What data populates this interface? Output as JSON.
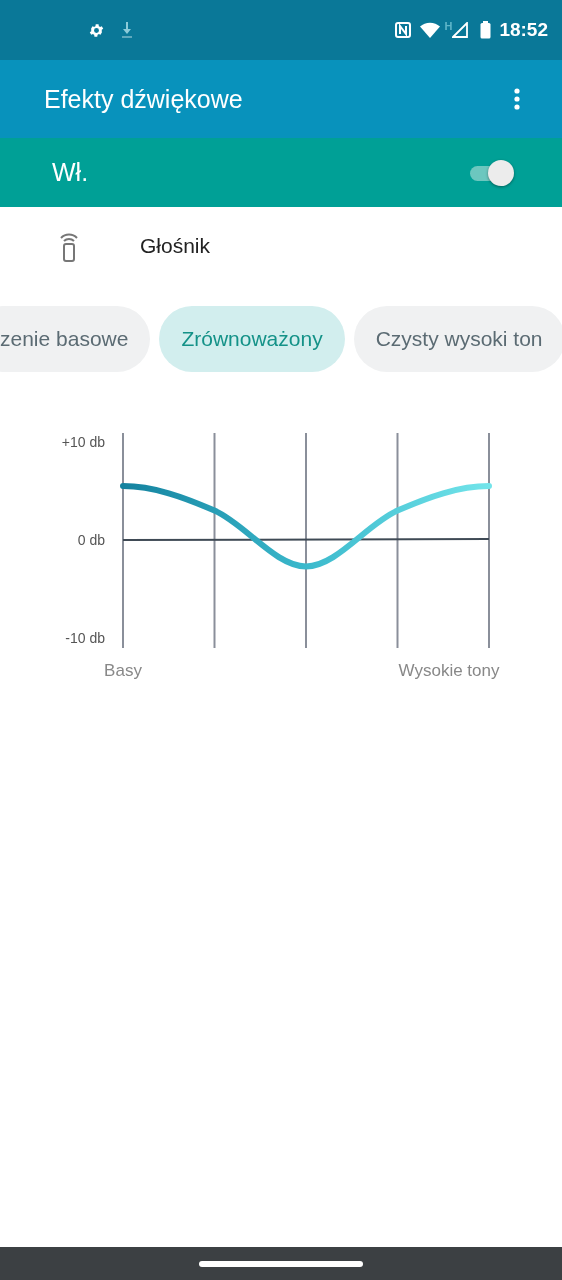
{
  "status_bar": {
    "network_type": "H",
    "time": "18:52"
  },
  "app_bar": {
    "title": "Efekty dźwiękowe"
  },
  "master_switch": {
    "label": "Wł.",
    "on": true
  },
  "device": {
    "name": "Głośnik"
  },
  "presets": [
    {
      "label": "zenie basowe",
      "selected": false
    },
    {
      "label": "Zrównoważony",
      "selected": true
    },
    {
      "label": "Czysty wysoki ton",
      "selected": false
    }
  ],
  "equalizer": {
    "scale_labels": [
      "+10 db",
      "0 db",
      "-10 db"
    ],
    "low_end_label": "Basy",
    "high_end_label": "Wysokie tony"
  }
}
